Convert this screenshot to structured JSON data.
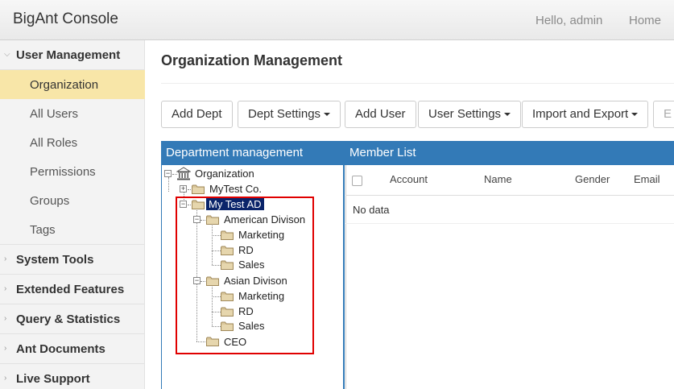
{
  "header": {
    "brand": "BigAnt Console",
    "greeting": "Hello, admin",
    "home": "Home"
  },
  "sidebar": {
    "user_management": "User Management",
    "items": [
      {
        "label": "Organization",
        "active": true
      },
      {
        "label": "All Users"
      },
      {
        "label": "All Roles"
      },
      {
        "label": "Permissions"
      },
      {
        "label": "Groups"
      },
      {
        "label": "Tags"
      }
    ],
    "sections": [
      "System Tools",
      "Extended Features",
      "Query & Statistics",
      "Ant Documents",
      "Live Support"
    ]
  },
  "main": {
    "title": "Organization Management",
    "buttons": {
      "add_dept": "Add Dept",
      "dept_settings": "Dept Settings",
      "add_user": "Add User",
      "user_settings": "User Settings",
      "import_export": "Import and Export",
      "cut": "E"
    },
    "dept_panel_title": "Department management",
    "member_panel_title": "Member List",
    "columns": [
      "Account",
      "Name",
      "Gender",
      "Email"
    ],
    "empty_text": "No data"
  },
  "tree": {
    "root": "Organization",
    "nodes": {
      "mytest_co": "MyTest Co.",
      "mytest_ad": "My Test AD",
      "american": "American Divison",
      "am_marketing": "Marketing",
      "am_rd": "RD",
      "am_sales": "Sales",
      "asian": "Asian Divison",
      "as_marketing": "Marketing",
      "as_rd": "RD",
      "as_sales": "Sales",
      "ceo": "CEO"
    }
  },
  "colors": {
    "accent": "#337ab7",
    "active_item": "#f8e6a8",
    "selection": "#0a246a",
    "highlight_box": "#e00000"
  }
}
